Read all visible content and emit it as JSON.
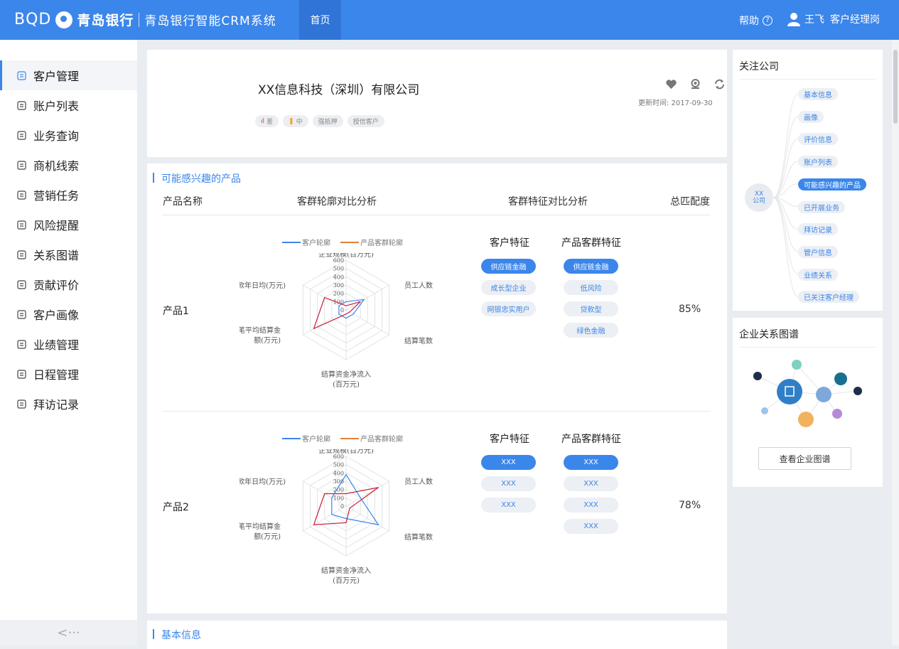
{
  "header": {
    "brand": "BQD",
    "bank_name": "青岛银行",
    "system_name": "青岛银行智能CRM系统",
    "nav_home": "首页",
    "help": "帮助",
    "user_name": "王飞",
    "user_role": "客户经理岗"
  },
  "sidebar": {
    "items": [
      {
        "label": "客户管理",
        "icon": "customer-icon"
      },
      {
        "label": "账户列表",
        "icon": "account-list-icon"
      },
      {
        "label": "业务查询",
        "icon": "business-query-icon"
      },
      {
        "label": "商机线索",
        "icon": "opportunity-icon"
      },
      {
        "label": "营销任务",
        "icon": "marketing-task-icon"
      },
      {
        "label": "风险提醒",
        "icon": "risk-alert-icon"
      },
      {
        "label": "关系图谱",
        "icon": "relation-graph-icon"
      },
      {
        "label": "贡献评价",
        "icon": "contribution-icon"
      },
      {
        "label": "客户画像",
        "icon": "portrait-icon"
      },
      {
        "label": "业绩管理",
        "icon": "performance-icon"
      },
      {
        "label": "日程管理",
        "icon": "schedule-icon"
      },
      {
        "label": "拜访记录",
        "icon": "visit-record-icon"
      }
    ],
    "collapse": "<···"
  },
  "company": {
    "name": "XX信息科技（深圳）有限公司",
    "update_time": "更新时间: 2017-09-30",
    "tags": [
      {
        "icon": "ıl",
        "label": "差"
      },
      {
        "icon": "❚",
        "label": "中"
      },
      {
        "icon": "",
        "label": "强抵押"
      },
      {
        "icon": "",
        "label": "授信客户"
      }
    ]
  },
  "products": {
    "section_title": "可能感兴趣的产品",
    "headers": {
      "name": "产品名称",
      "profile": "客群轮廓对比分析",
      "feature": "客群特征对比分析",
      "match": "总匹配度"
    },
    "legend": {
      "customer": "客户轮廓",
      "product": "产品客群轮廓"
    },
    "feature_heads": {
      "customer": "客户特征",
      "product": "产品客群特征"
    },
    "radar_axes": [
      "企业规模(百万元)",
      "员工人数",
      "结算笔数",
      "结算资金净流入",
      "(百万元)",
      "单笔平均结算金",
      "额(万元)",
      "存款年日均(万元)"
    ],
    "radar_ticks": [
      "600",
      "500",
      "400",
      "300",
      "200",
      "100",
      "0"
    ],
    "items": [
      {
        "name": "产品1",
        "match": "85%",
        "customer_features": [
          {
            "label": "供应链金融",
            "on": true
          },
          {
            "label": "成长型企业",
            "on": false
          },
          {
            "label": "网银忠实用户",
            "on": false
          }
        ],
        "product_features": [
          {
            "label": "供应链金融",
            "on": true
          },
          {
            "label": "低风险",
            "on": false
          },
          {
            "label": "贷款型",
            "on": false
          },
          {
            "label": "绿色金融",
            "on": false
          }
        ],
        "customer_profile": [
          100,
          250,
          100,
          100,
          100,
          100
        ],
        "product_profile": [
          50,
          200,
          50,
          50,
          450,
          300
        ]
      },
      {
        "name": "产品2",
        "match": "78%",
        "customer_features": [
          {
            "label": "XXX",
            "on": true
          },
          {
            "label": "XXX",
            "on": false
          },
          {
            "label": "XXX",
            "on": false
          }
        ],
        "product_features": [
          {
            "label": "XXX",
            "on": true
          },
          {
            "label": "XXX",
            "on": false
          },
          {
            "label": "XXX",
            "on": false
          },
          {
            "label": "XXX",
            "on": false
          }
        ],
        "customer_profile": [
          380,
          200,
          450,
          150,
          200,
          200
        ],
        "product_profile": [
          150,
          450,
          50,
          200,
          450,
          300
        ]
      }
    ]
  },
  "basic_info": {
    "section_title": "基本信息"
  },
  "follow": {
    "title": "关注公司",
    "hub": "XX公司",
    "hub_line1": "XX",
    "hub_line2": "公司",
    "nodes": [
      {
        "label": "基本信息",
        "on": false
      },
      {
        "label": "画像",
        "on": false
      },
      {
        "label": "评价信息",
        "on": false
      },
      {
        "label": "账户列表",
        "on": false
      },
      {
        "label": "可能感兴趣的产品",
        "on": true
      },
      {
        "label": "已开展业务",
        "on": false
      },
      {
        "label": "拜访记录",
        "on": false
      },
      {
        "label": "管户信息",
        "on": false
      },
      {
        "label": "业绩关系",
        "on": false
      },
      {
        "label": "已关注客户经理",
        "on": false
      }
    ]
  },
  "graph": {
    "title": "企业关系图谱",
    "button": "查看企业图谱"
  },
  "colors": {
    "primary": "#3b86ea",
    "customer_line": "#3b86ea",
    "product_line": "#e0823a",
    "overlay_line": "#c81e3a"
  }
}
